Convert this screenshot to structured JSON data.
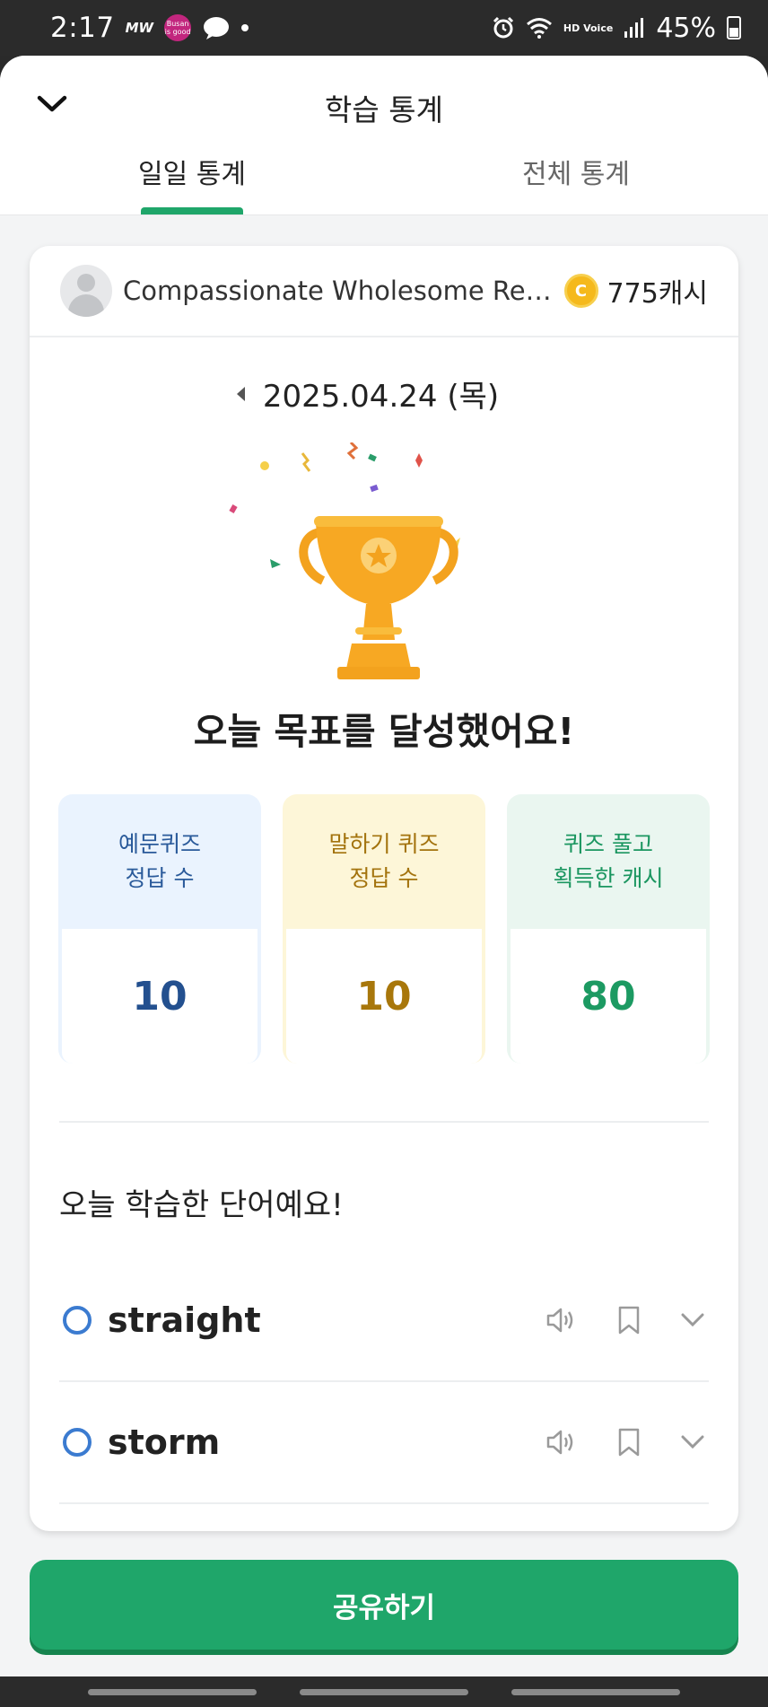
{
  "status_bar": {
    "time": "2:17",
    "carrier_label": "MW",
    "badge_text": "Busan is good",
    "battery": "45%",
    "hd_label": "HD Voice"
  },
  "header": {
    "title": "학습 통계",
    "tabs": [
      {
        "label": "일일 통계",
        "active": true
      },
      {
        "label": "전체 통계",
        "active": false
      }
    ]
  },
  "user": {
    "name": "Compassionate Wholesome Reb...",
    "cash": "775캐시"
  },
  "date": "2025.04.24 (목)",
  "goal_message": "오늘 목표를 달성했어요!",
  "stats": [
    {
      "label_line1": "예문퀴즈",
      "label_line2": "정답 수",
      "value": "10",
      "color": "#23508f"
    },
    {
      "label_line1": "말하기 퀴즈",
      "label_line2": "정답 수",
      "value": "10",
      "color": "#a8770b"
    },
    {
      "label_line1": "퀴즈 풀고",
      "label_line2": "획득한 캐시",
      "value": "80",
      "color": "#1c9a62"
    }
  ],
  "words_title": "오늘 학습한 단어예요!",
  "words": [
    {
      "word": "straight"
    },
    {
      "word": "storm"
    }
  ],
  "share_label": "공유하기",
  "colors": {
    "accent": "#1fa66a",
    "trophy": "#f7a823"
  }
}
